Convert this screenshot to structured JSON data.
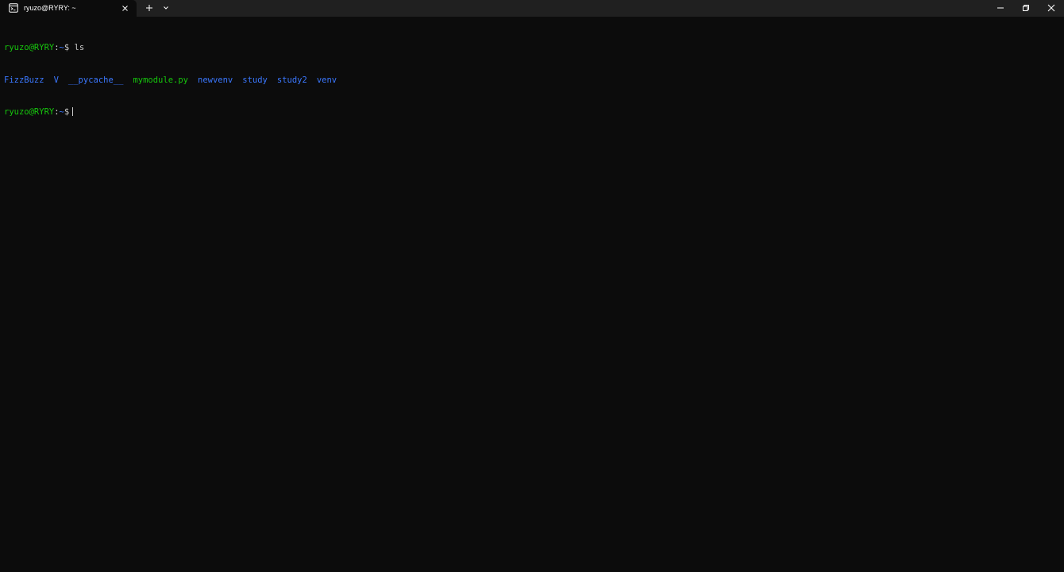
{
  "tab": {
    "title": "ryuzo@RYRY: ~",
    "icon": "terminal-icon"
  },
  "titlebar": {
    "new_tab_icon": "plus-icon",
    "dropdown_icon": "chevron-down-icon",
    "minimize_icon": "minimize-icon",
    "restore_icon": "restore-icon",
    "close_icon": "close-icon"
  },
  "terminal": {
    "prompt": {
      "user_host": "ryuzo@RYRY",
      "separator": ":",
      "path": "~",
      "symbol": "$"
    },
    "command": "ls",
    "ls_output": [
      {
        "name": "FizzBuzz",
        "type": "dir"
      },
      {
        "name": "V",
        "type": "dir"
      },
      {
        "name": "__pycache__",
        "type": "dir"
      },
      {
        "name": "mymodule.py",
        "type": "file-exec"
      },
      {
        "name": "newvenv",
        "type": "dir"
      },
      {
        "name": "study",
        "type": "dir"
      },
      {
        "name": "study2",
        "type": "dir"
      },
      {
        "name": "venv",
        "type": "dir"
      }
    ]
  },
  "colors": {
    "background": "#0c0c0c",
    "titlebar": "#202020",
    "prompt_user": "#16c60c",
    "prompt_path": "#3b78ff",
    "directory": "#3b78ff",
    "executable": "#16c60c",
    "text": "#cccccc"
  }
}
